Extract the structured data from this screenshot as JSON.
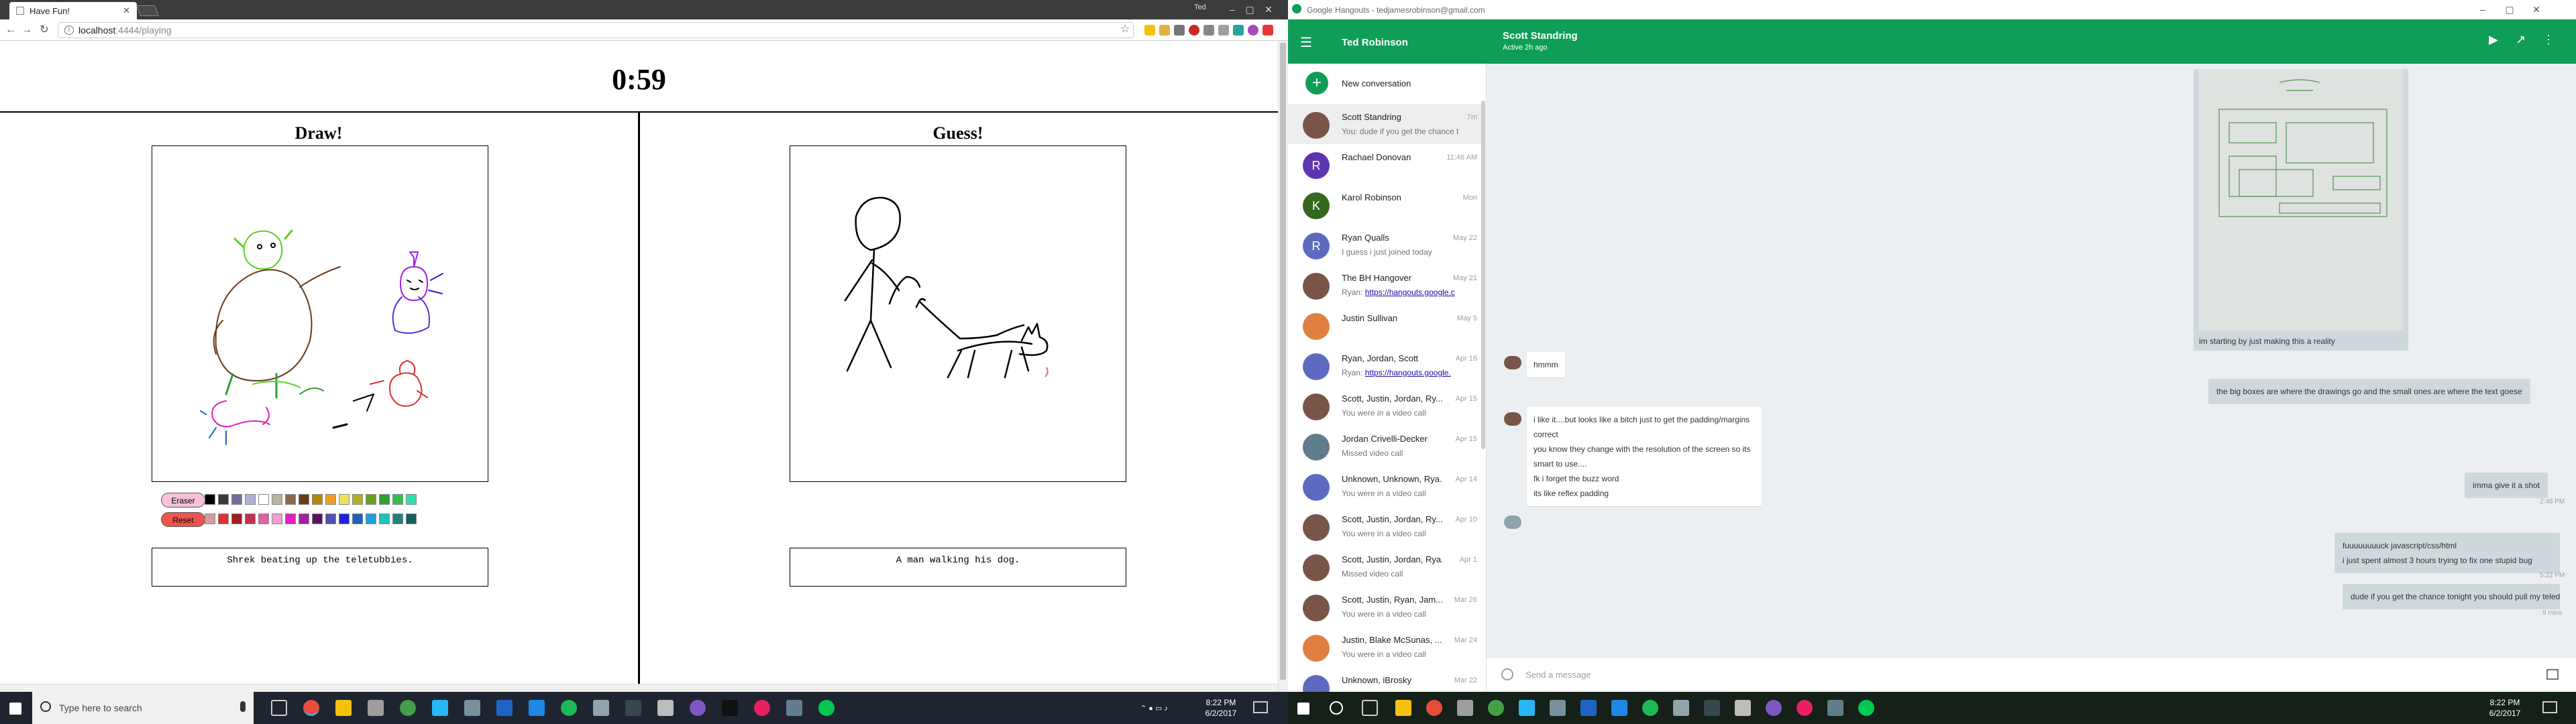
{
  "left_browser": {
    "tab_title": "Have Fun!",
    "url_host": "localhost",
    "url_path": ":4444/playing",
    "user_label": "Ted"
  },
  "game": {
    "timer": "0:59",
    "draw_panel": {
      "title": "Draw!",
      "caption": "Shrek beating up the teletubbies.",
      "eraser_label": "Eraser",
      "reset_label": "Reset"
    },
    "guess_panel": {
      "title": "Guess!",
      "caption": "A man walking his dog."
    },
    "palette_row1": [
      "#000000",
      "#3a3a3a",
      "#6e6e9e",
      "#b0b0d8",
      "#ffffff",
      "#b5b5a0",
      "#8a6a4a",
      "#6a3a1a",
      "#b8860b",
      "#f0a020",
      "#f0e060",
      "#b0b020",
      "#6aa020",
      "#30a030",
      "#30c050",
      "#30e0b0"
    ],
    "palette_row2": [
      "#d0a0a0",
      "#e03030",
      "#a02020",
      "#c03050",
      "#e060a0",
      "#f0a0d0",
      "#e020c0",
      "#a020a0",
      "#601060",
      "#5050b0",
      "#2020e0",
      "#2060c0",
      "#20a0e0",
      "#20c0c0",
      "#208080",
      "#106060"
    ]
  },
  "taskbar": {
    "search_placeholder": "Type here to search",
    "left_time": "8:22 PM",
    "left_date": "6/2/2017",
    "right_time": "8:22 PM",
    "right_date": "6/2/2017"
  },
  "hangouts": {
    "window_title": "Google Hangouts - tedjamesrobinson@gmail.com",
    "account_name": "Ted Robinson",
    "active_contact": "Scott Standring",
    "active_status": "Active 2h ago",
    "new_conversation": "New conversation",
    "conversations": [
      {
        "name": "Scott Standring",
        "date": "7m",
        "preview": "You: dude if you get the chance t",
        "color": "#795548",
        "initial": ""
      },
      {
        "name": "Rachael Donovan",
        "date": "11:46 AM",
        "preview": "",
        "color": "#5e35b1",
        "initial": "R"
      },
      {
        "name": "Karol Robinson",
        "date": "Mon",
        "preview": "",
        "color": "#33691e",
        "initial": "K"
      },
      {
        "name": "Ryan Qualls",
        "date": "May 22",
        "preview": "I guess i just joined today",
        "color": "#5c6bc0",
        "initial": "R"
      },
      {
        "name": "The BH Hangover",
        "date": "May 21",
        "preview_prefix": "Ryan: ",
        "preview_link": "https://hangouts.google.c",
        "color": "#795548",
        "initial": ""
      },
      {
        "name": "Justin Sullivan",
        "date": "May 5",
        "preview": "",
        "color": "#e08040",
        "initial": ""
      },
      {
        "name": "Ryan, Jordan, Scott",
        "date": "Apr 16",
        "preview_prefix": "Ryan: ",
        "preview_link": "https://hangouts.google.",
        "color": "#5c6bc0",
        "initial": ""
      },
      {
        "name": "Scott, Justin, Jordan, Ry...",
        "date": "Apr 15",
        "preview": "You were in a video call",
        "color": "#795548",
        "initial": ""
      },
      {
        "name": "Jordan Crivelli-Decker",
        "date": "Apr 15",
        "preview": "Missed video call",
        "color": "#607d8b",
        "initial": ""
      },
      {
        "name": "Unknown, Unknown, Rya...",
        "date": "Apr 14",
        "preview": "You were in a video call",
        "color": "#5c6bc0",
        "initial": ""
      },
      {
        "name": "Scott, Justin, Jordan, Ry...",
        "date": "Apr 10",
        "preview": "You were in a video call",
        "color": "#795548",
        "initial": ""
      },
      {
        "name": "Scott, Justin, Jordan, Rya...",
        "date": "Apr 1",
        "preview": "Missed video call",
        "color": "#795548",
        "initial": ""
      },
      {
        "name": "Scott, Justin, Ryan, Jam...",
        "date": "Mar 26",
        "preview": "You were in a video call",
        "color": "#795548",
        "initial": ""
      },
      {
        "name": "Justin, Blake McSunas, ...",
        "date": "Mar 24",
        "preview": "You were in a video call",
        "color": "#e08040",
        "initial": ""
      },
      {
        "name": "Unknown, iBrosky",
        "date": "Mar 22",
        "preview": "",
        "color": "#5c6bc0",
        "initial": ""
      }
    ],
    "messages": {
      "photo_caption": "im starting by just making this a reality",
      "reply_hmm": "hmmm",
      "mine_boxes": "the big boxes are where the drawings go and the small ones are where the text goese",
      "reply_long": [
        "i like it....but looks like a bitch just to get the padding/margins correct",
        "you know they change with the resolution of the screen so its smart to use....",
        "fk i forget the buzz word",
        "its like reflex padding"
      ],
      "mine_shot": "imma give it a shot",
      "ts_shot": "2:48 PM",
      "mine_js": "fuuuuuuuuck javascript/css/html",
      "mine_bug": "i just spent almost 3 hours trying to fix one stupid bug",
      "ts_bug": "5:22 PM",
      "mine_last": "dude if you get the chance tonight you should pull my teledoodle branch and check out it's current state",
      "ts_last": "9 mins"
    },
    "input_placeholder": "Send a message"
  }
}
